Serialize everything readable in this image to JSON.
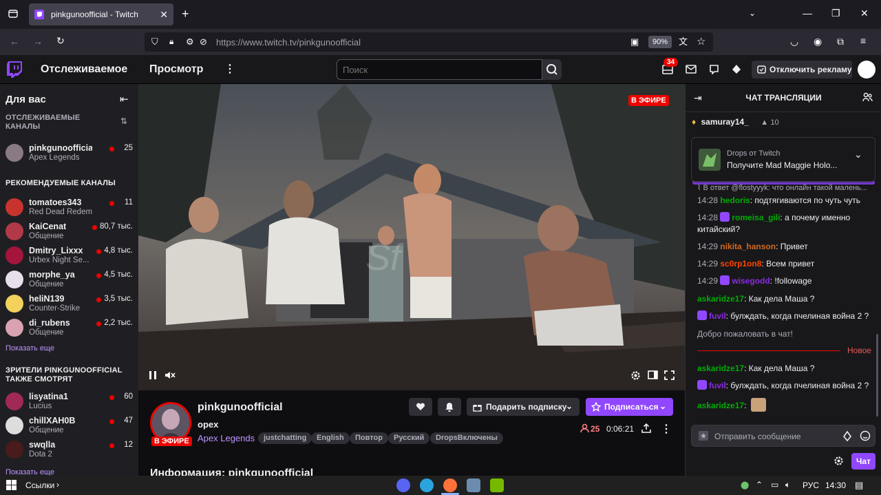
{
  "browser": {
    "tab_title": "pinkgunoofficial - Twitch",
    "url": "https://www.twitch.tv/pinkgunoofficial",
    "zoom": "90%"
  },
  "nav": {
    "following": "Отслеживаемое",
    "browse": "Просмотр",
    "search_placeholder": "Поиск",
    "notif_count": "34",
    "ads_button": "Отключить рекламу"
  },
  "sidebar": {
    "title": "Для вас",
    "followed_header": "ОТСЛЕЖИВАЕМЫЕ КАНАЛЫ",
    "followed": [
      {
        "name": "pinkgunoofficial",
        "game": "Apex Legends",
        "viewers": "25"
      }
    ],
    "recommended_header": "РЕКОМЕНДУЕМЫЕ КАНАЛЫ",
    "recommended": [
      {
        "name": "tomatoes343",
        "game": "Red Dead Redempt...",
        "viewers": "11"
      },
      {
        "name": "KaiCenat",
        "game": "Общение",
        "viewers": "80,7 тыс."
      },
      {
        "name": "Dmitry_Lixxx",
        "game": "Urbex Night Se...",
        "viewers": "4,8 тыс."
      },
      {
        "name": "morphe_ya",
        "game": "Общение",
        "viewers": "4,5 тыс."
      },
      {
        "name": "heliN139",
        "game": "Counter-Strike",
        "viewers": "3,5 тыс."
      },
      {
        "name": "di_rubens",
        "game": "Общение",
        "viewers": "2,2 тыс."
      }
    ],
    "show_more": "Показать еще",
    "also_watch_header_1": "ЗРИТЕЛИ PINKGUNOOFFICIAL",
    "also_watch_header_2": "ТАКЖЕ СМОТРЯТ",
    "also_watch": [
      {
        "name": "lisyatina1",
        "game": "Lucius",
        "viewers": "60"
      },
      {
        "name": "chillXAH0B",
        "game": "Общение",
        "viewers": "47"
      },
      {
        "name": "swqlla",
        "game": "Dota 2",
        "viewers": "12"
      }
    ],
    "show_more_2": "Показать еще"
  },
  "video": {
    "live_label": "В ЭФИРЕ"
  },
  "stream": {
    "name": "pinkgunoofficial",
    "title": "opex",
    "game": "Apex Legends",
    "live_label": "В ЭФИРЕ",
    "tags": [
      "justchatting",
      "English",
      "Повтор",
      "Русский",
      "DropsВключены"
    ],
    "gift_button": "Подарить подписку",
    "subscribe_button": "Подписаться",
    "viewers": "25",
    "uptime": "0:06:21",
    "info_heading": "Информация: pinkgunoofficial"
  },
  "chat": {
    "header": "ЧАТ ТРАНСЛЯЦИИ",
    "pinned_user": "samuray14_",
    "pinned_count": "10",
    "drops_title": "Drops от Twitch",
    "drops_text": "Получите Mad Maggie Holo...",
    "reply_line": "В ответ @flostyyyk: что онлайн такой малень...",
    "messages": [
      {
        "time": "14:28",
        "user": "hedoris",
        "text": ": подтягиваются по чуть чуть"
      },
      {
        "time": "14:28",
        "user": "romeisa_gili",
        "text": ": а почему именно китайский?"
      },
      {
        "time": "14:29",
        "user": "nikita_hanson",
        "text": ": Привет"
      },
      {
        "time": "14:29",
        "user": "sc0rp1on8",
        "text": ": Всем привет"
      },
      {
        "time": "14:29",
        "user": "wisegodd",
        "text": ": !followage"
      },
      {
        "time": "",
        "user": "askaridze17",
        "text": ": Как дела Маша ?"
      },
      {
        "time": "",
        "user": "fuvil",
        "text": ": булждать, когда пчелиная война 2 ?"
      }
    ],
    "welcome": "Добро пожаловать в чат!",
    "new_label": "Новое",
    "messages_new": [
      {
        "user": "askaridze17",
        "text": ": Как дела Маша ?"
      },
      {
        "user": "fuvil",
        "text": ": булждать, когда пчелиная война 2 ?"
      },
      {
        "user": "askaridze17",
        "text": ":"
      }
    ],
    "input_placeholder": "Отправить сообщение",
    "send_button": "Чат"
  },
  "taskbar": {
    "links": "Ссылки",
    "lang": "РУС",
    "time": "14:30"
  },
  "colors": {
    "twitch_purple": "#9147ff",
    "live_red": "#eb0400",
    "user_green": "#00ad03",
    "user_orange": "#d2691e",
    "user_red": "#ff4500",
    "user_purple": "#8a2be2"
  }
}
